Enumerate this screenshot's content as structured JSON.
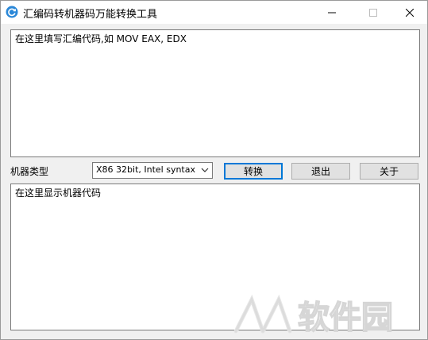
{
  "window": {
    "title": "汇编码转机器码万能转换工具"
  },
  "input": {
    "placeholder": "在这里填写汇编代码,如 MOV EAX, EDX"
  },
  "controls": {
    "machine_type_label": "机器类型",
    "machine_type_selected": "X86 32bit, Intel syntax",
    "convert_label": "转换",
    "exit_label": "退出",
    "about_label": "关于"
  },
  "output": {
    "placeholder": "在这里显示机器代码"
  },
  "watermark": {
    "text": "软件园"
  },
  "colors": {
    "accent": "#0078d7",
    "titlebar": "#ffffff",
    "window_bg": "#f0f0f0"
  }
}
